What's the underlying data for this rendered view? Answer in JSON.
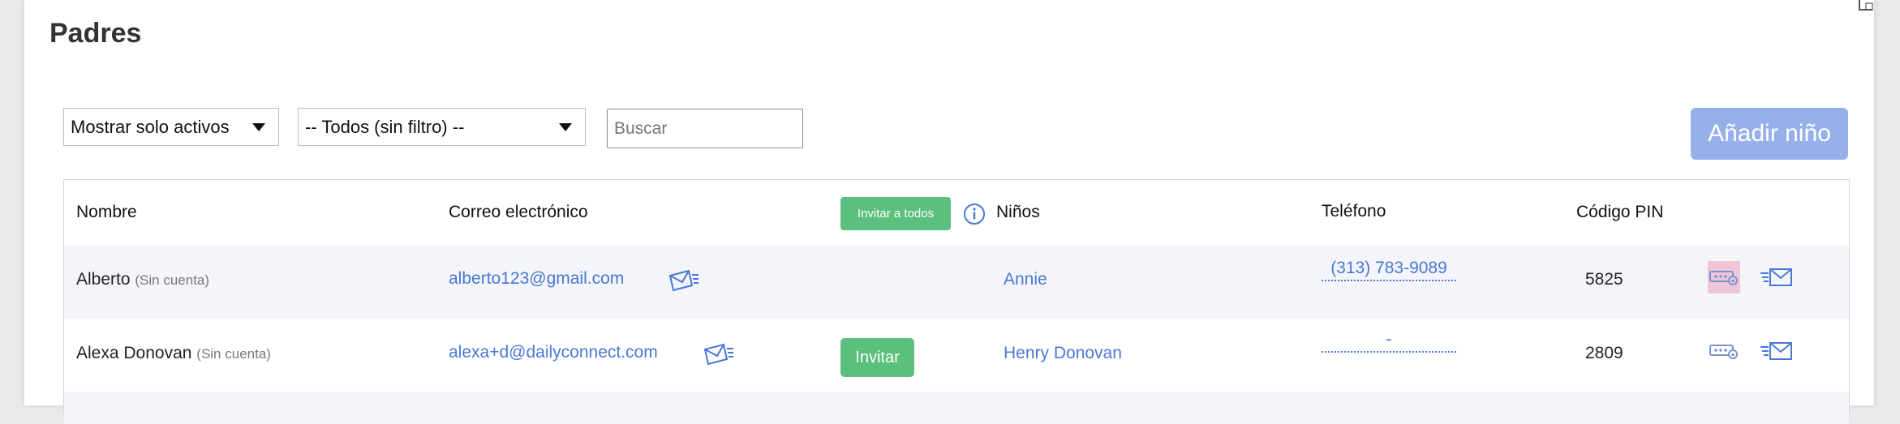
{
  "page": {
    "title": "Padres"
  },
  "filters": {
    "status_select": "Mostrar solo activos",
    "group_select": "-- Todos (sin filtro) --",
    "search_placeholder": "Buscar"
  },
  "actions": {
    "add_child": "Añadir niño"
  },
  "table": {
    "headers": {
      "name": "Nombre",
      "email": "Correo electrónico",
      "invite_all": "Invitar a todos",
      "children": "Niños",
      "phone": "Teléfono",
      "pin": "Código PIN"
    },
    "rows": [
      {
        "name": "Alberto",
        "account_status": "(Sin cuenta)",
        "email": "alberto123@gmail.com",
        "invite": "",
        "children": "Annie",
        "phone": "(313) 783-9089",
        "pin": "5825"
      },
      {
        "name": "Alexa Donovan",
        "account_status": "(Sin cuenta)",
        "email": "alexa+d@dailyconnect.com",
        "invite": "Invitar",
        "children": "Henry Donovan",
        "phone": "-",
        "pin": "2809"
      }
    ]
  },
  "colors": {
    "accent_link": "#4a77d4",
    "invite_green": "#5bbf7d",
    "add_button": "#98b0ea",
    "row_alt": "#f3f5fa"
  }
}
